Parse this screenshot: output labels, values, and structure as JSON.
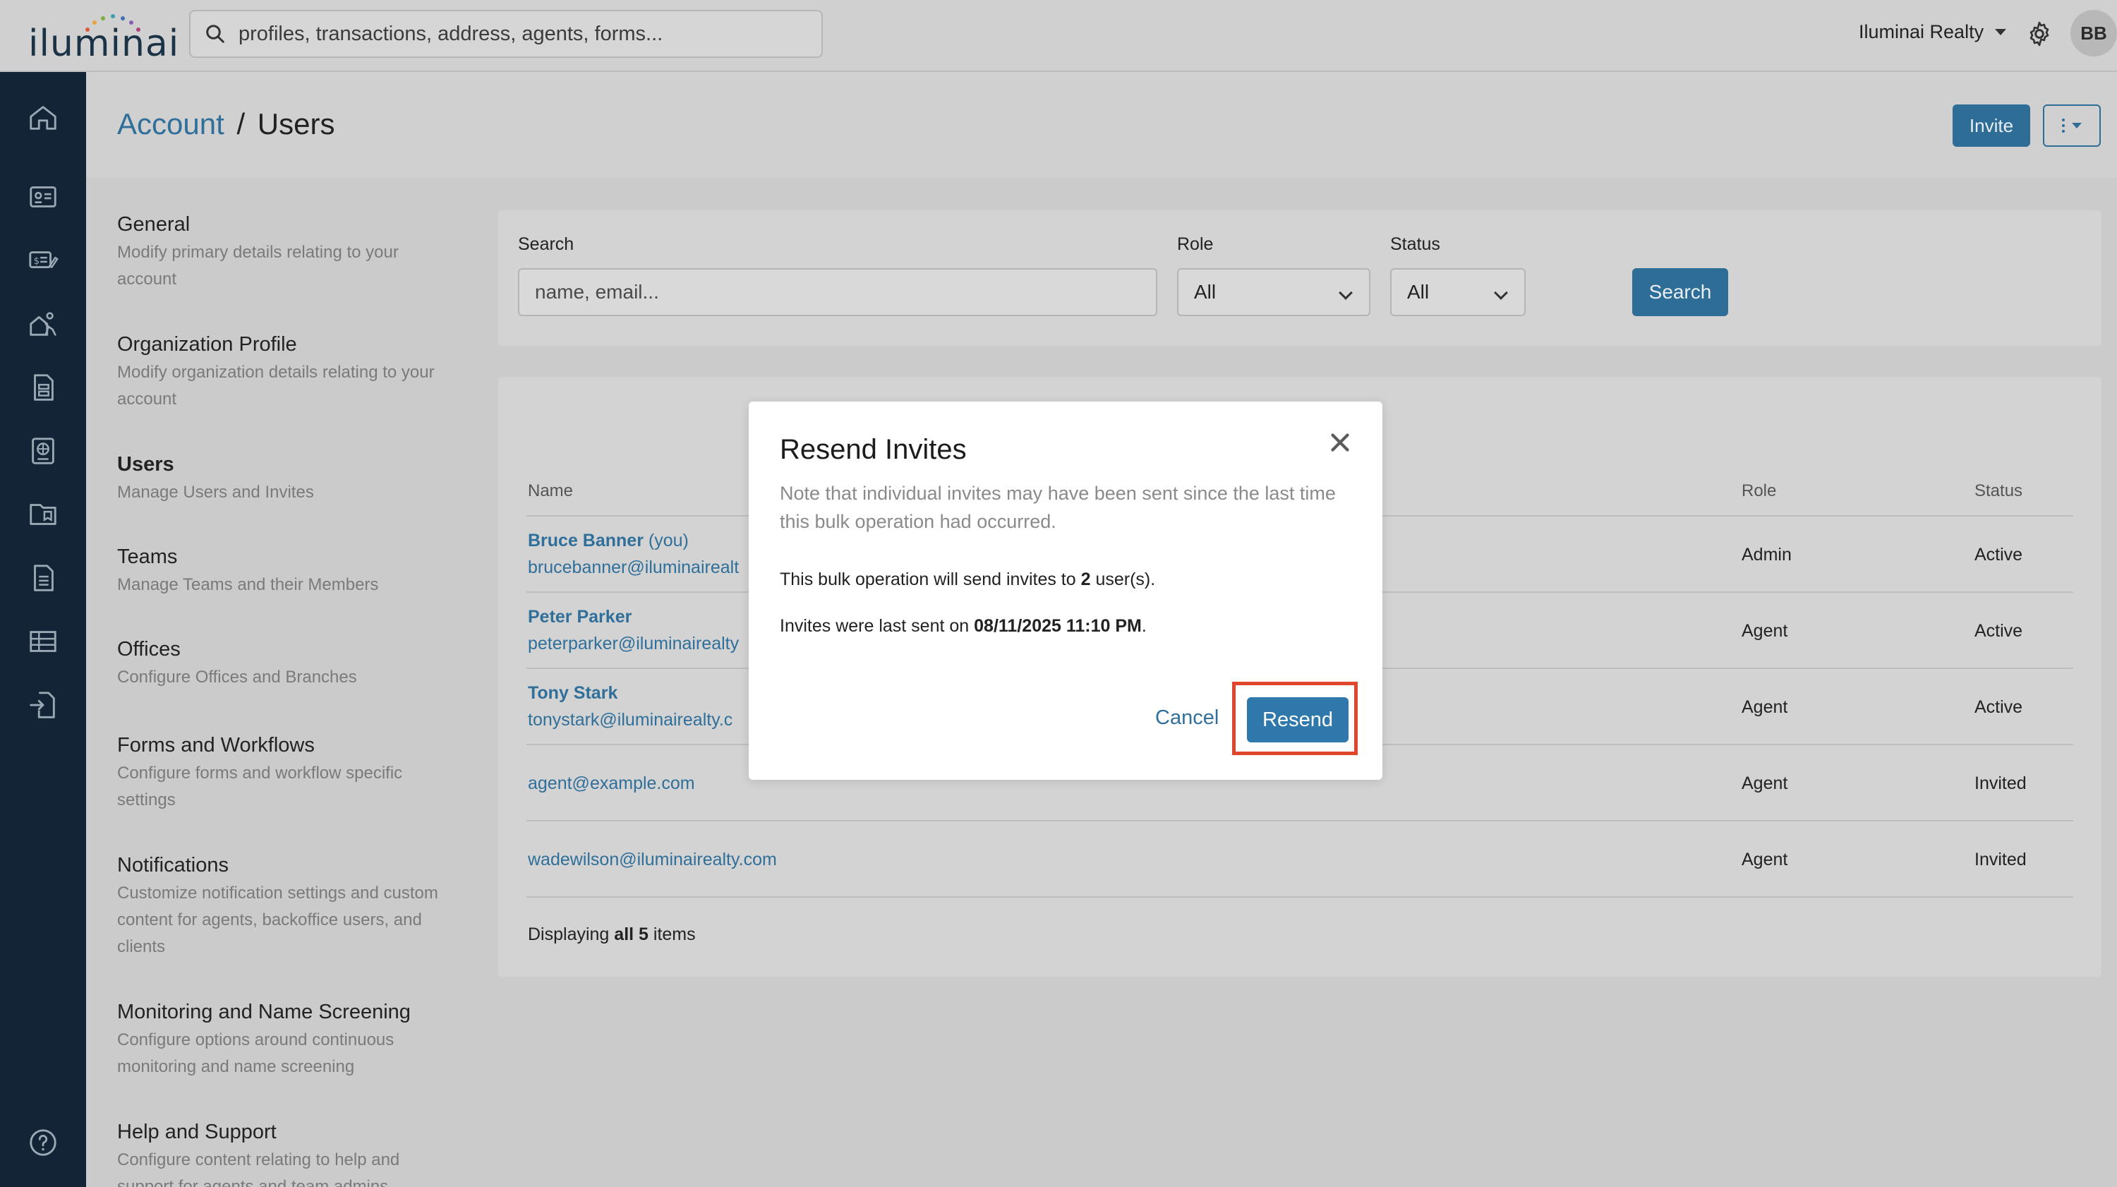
{
  "app": {
    "logo_text": "iluminai"
  },
  "topbar": {
    "search_placeholder": "profiles, transactions, address, agents, forms...",
    "org_name": "Iluminai Realty",
    "avatar_initials": "BB"
  },
  "breadcrumb": {
    "parent": "Account",
    "separator": "/",
    "current": "Users"
  },
  "header_actions": {
    "invite_label": "Invite"
  },
  "settings_nav": [
    {
      "title": "General",
      "desc": "Modify primary details relating to your account"
    },
    {
      "title": "Organization Profile",
      "desc": "Modify organization details relating to your account"
    },
    {
      "title": "Users",
      "desc": "Manage Users and Invites"
    },
    {
      "title": "Teams",
      "desc": "Manage Teams and their Members"
    },
    {
      "title": "Offices",
      "desc": "Configure Offices and Branches"
    },
    {
      "title": "Forms and Workflows",
      "desc": "Configure forms and workflow specific settings"
    },
    {
      "title": "Notifications",
      "desc": "Customize notification settings and custom content for agents, backoffice users, and clients"
    },
    {
      "title": "Monitoring and Name Screening",
      "desc": "Configure options around continuous monitoring and name screening"
    },
    {
      "title": "Help and Support",
      "desc": "Configure content relating to help and support for agents and team admins"
    }
  ],
  "filters": {
    "search_label": "Search",
    "search_placeholder": "name, email...",
    "role_label": "Role",
    "role_value": "All",
    "status_label": "Status",
    "status_value": "All",
    "search_button": "Search"
  },
  "table": {
    "headers": {
      "name": "Name",
      "role": "Role",
      "status": "Status"
    },
    "rows": [
      {
        "name": "Bruce Banner",
        "suffix": "(you)",
        "email": "brucebanner@iluminairealt",
        "role": "Admin",
        "status": "Active"
      },
      {
        "name": "Peter Parker",
        "suffix": "",
        "email": "peterparker@iluminairealty",
        "role": "Agent",
        "status": "Active"
      },
      {
        "name": "Tony Stark",
        "suffix": "",
        "email": "tonystark@iluminairealty.c",
        "role": "Agent",
        "status": "Active"
      },
      {
        "name": "",
        "suffix": "",
        "email": "agent@example.com",
        "role": "Agent",
        "status": "Invited"
      },
      {
        "name": "",
        "suffix": "",
        "email": "wadewilson@iluminairealty.com",
        "role": "Agent",
        "status": "Invited"
      }
    ],
    "footer_prefix": "Displaying",
    "footer_bold": "all 5",
    "footer_suffix": "items"
  },
  "modal": {
    "title": "Resend Invites",
    "note": "Note that individual invites may have been sent since the last time this bulk operation had occurred.",
    "p1_prefix": "This bulk operation will send invites to",
    "p1_count": "2",
    "p1_suffix": "user(s).",
    "p2_prefix": "Invites were last sent on",
    "p2_date": "08/11/2025 11:10 PM",
    "p2_suffix": ".",
    "cancel_label": "Cancel",
    "resend_label": "Resend"
  },
  "colors": {
    "primary": "#2d6d96",
    "link": "#2f6f9a",
    "rail": "#122436",
    "highlight": "#e0462c"
  },
  "icons": {
    "rail": [
      "home-icon",
      "contact-card-icon",
      "transactions-icon",
      "agents-icon",
      "forms-icon",
      "globe-doc-icon",
      "folder-icon",
      "document-icon",
      "table-icon",
      "import-icon",
      "help-icon"
    ]
  }
}
